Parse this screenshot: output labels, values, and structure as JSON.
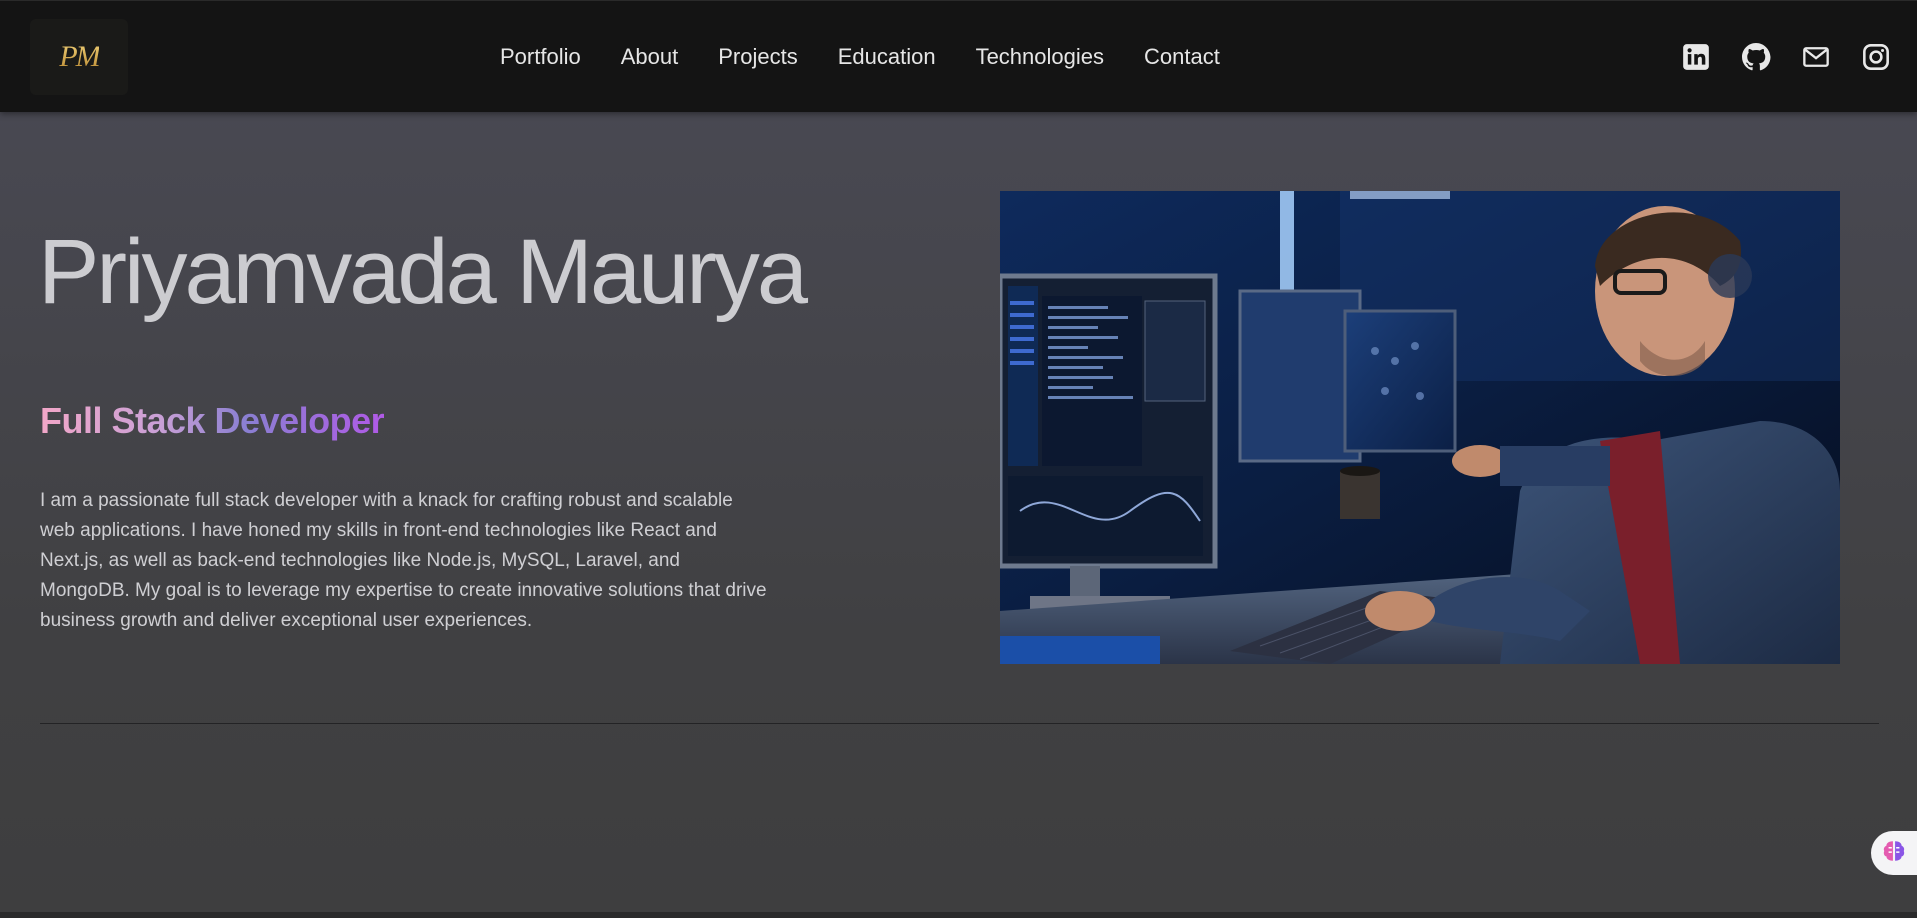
{
  "header": {
    "logo_text": "PM",
    "nav": [
      {
        "label": "Portfolio"
      },
      {
        "label": "About"
      },
      {
        "label": "Projects"
      },
      {
        "label": "Education"
      },
      {
        "label": "Technologies"
      },
      {
        "label": "Contact"
      }
    ],
    "social_icons": [
      "linkedin-icon",
      "github-icon",
      "mail-icon",
      "instagram-icon"
    ]
  },
  "hero": {
    "name": "Priyamvada Maurya",
    "role": "Full Stack Developer",
    "bio": "I am a passionate full stack developer with a knack for crafting robust and scalable web applications. I have honed my skills in front-end technologies like React and Next.js, as well as back-end technologies like Node.js, MySQL, Laravel, and MongoDB. My goal is to leverage my expertise to create innovative solutions that drive business growth and deliver exceptional user experiences.",
    "image": "developer-at-workstation-photo"
  },
  "floating_button": {
    "icon": "brain-icon"
  },
  "colors": {
    "header_bg": "#141414",
    "page_bg": "#444448",
    "logo_gold": "#c9a24a",
    "role_gradient_start": "#f2a7c8",
    "role_gradient_end": "#b05ae6",
    "body_text": "#cfcfd3"
  }
}
